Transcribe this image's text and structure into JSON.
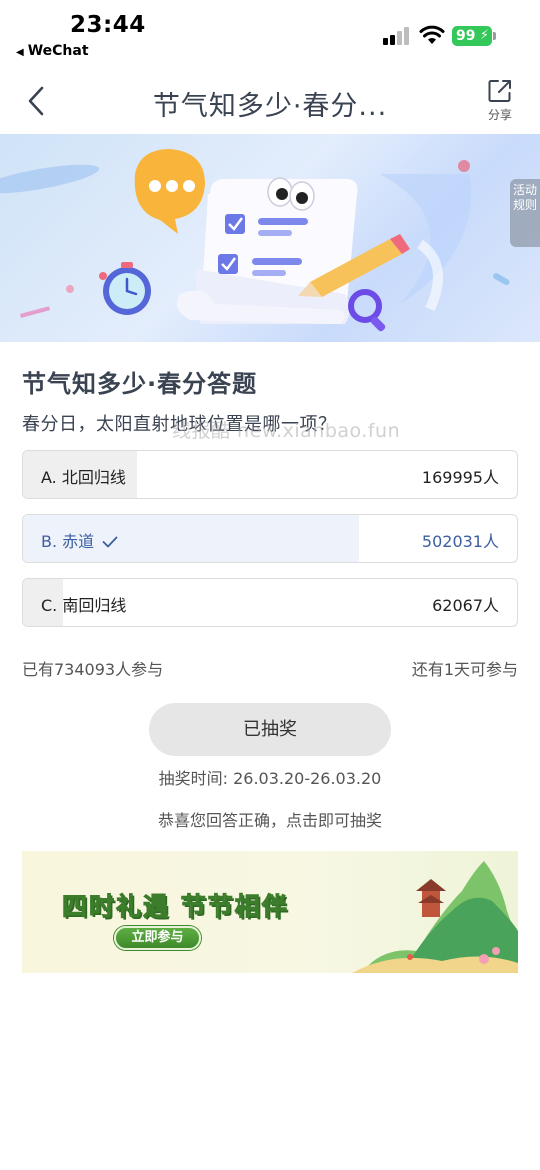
{
  "status_bar": {
    "time": "23:44",
    "back_app": "WeChat",
    "battery": "99"
  },
  "nav": {
    "title": "节气知多少·春分...",
    "share_label": "分享"
  },
  "banner": {
    "side_tab": "活动规则"
  },
  "quiz": {
    "title": "节气知多少·春分答题",
    "question": "春分日，太阳直射地球位置是哪一项？",
    "watermark": "线报酷 new.xianbao.fun",
    "options": [
      {
        "label": "A. 北回归线",
        "count": "169995人",
        "share": 0.23,
        "correct": false
      },
      {
        "label": "B. 赤道",
        "count": "502031人",
        "share": 0.68,
        "correct": true
      },
      {
        "label": "C. 南回归线",
        "count": "62067人",
        "share": 0.08,
        "correct": false
      }
    ],
    "participants": "已有734093人参与",
    "remaining": "还有1天可参与"
  },
  "draw": {
    "button_label": "已抽奖",
    "time": "抽奖时间: 26.03.20-26.03.20",
    "congrats": "恭喜您回答正确，点击即可抽奖"
  },
  "promo": {
    "title": "四时礼遇 节节相伴",
    "button_label": "立即参与"
  },
  "colors": {
    "correct_text": "#3c5ea0",
    "correct_fill": "#eef3fb",
    "battery": "#34c759"
  },
  "icons": [
    "signal-icon",
    "wifi-icon",
    "battery-icon",
    "back-chevron-icon",
    "share-icon",
    "check-icon"
  ]
}
